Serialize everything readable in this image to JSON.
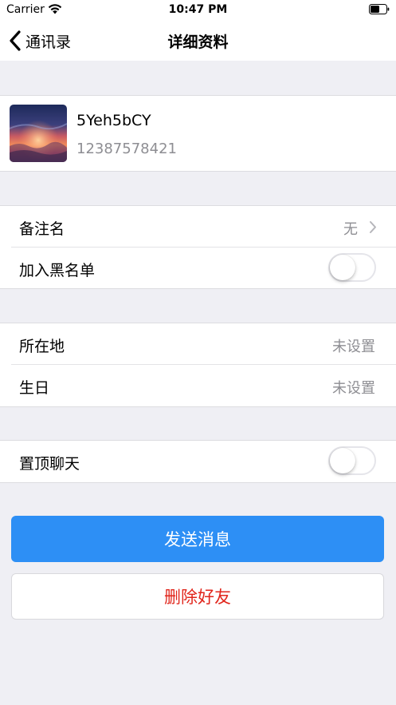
{
  "status_bar": {
    "carrier": "Carrier",
    "time": "10:47 PM"
  },
  "nav": {
    "back_label": "通讯录",
    "title": "详细资料"
  },
  "profile": {
    "name": "5Yeh5bCY",
    "phone": "12387578421"
  },
  "settings": {
    "remark": {
      "label": "备注名",
      "value": "无"
    },
    "blacklist": {
      "label": "加入黑名单",
      "on": false
    },
    "location": {
      "label": "所在地",
      "value": "未设置"
    },
    "birthday": {
      "label": "生日",
      "value": "未设置"
    },
    "pin_chat": {
      "label": "置顶聊天",
      "on": false
    }
  },
  "actions": {
    "send_message": "发送消息",
    "delete_friend": "删除好友"
  },
  "colors": {
    "background": "#efeff4",
    "accent_blue": "#2d8ff5",
    "danger_red": "#e1261c",
    "secondary_text": "#8e8e93"
  },
  "icons": {
    "back": "chevron-left-icon",
    "row_disclosure": "chevron-right-icon",
    "wifi": "wifi-icon",
    "battery": "battery-icon"
  }
}
